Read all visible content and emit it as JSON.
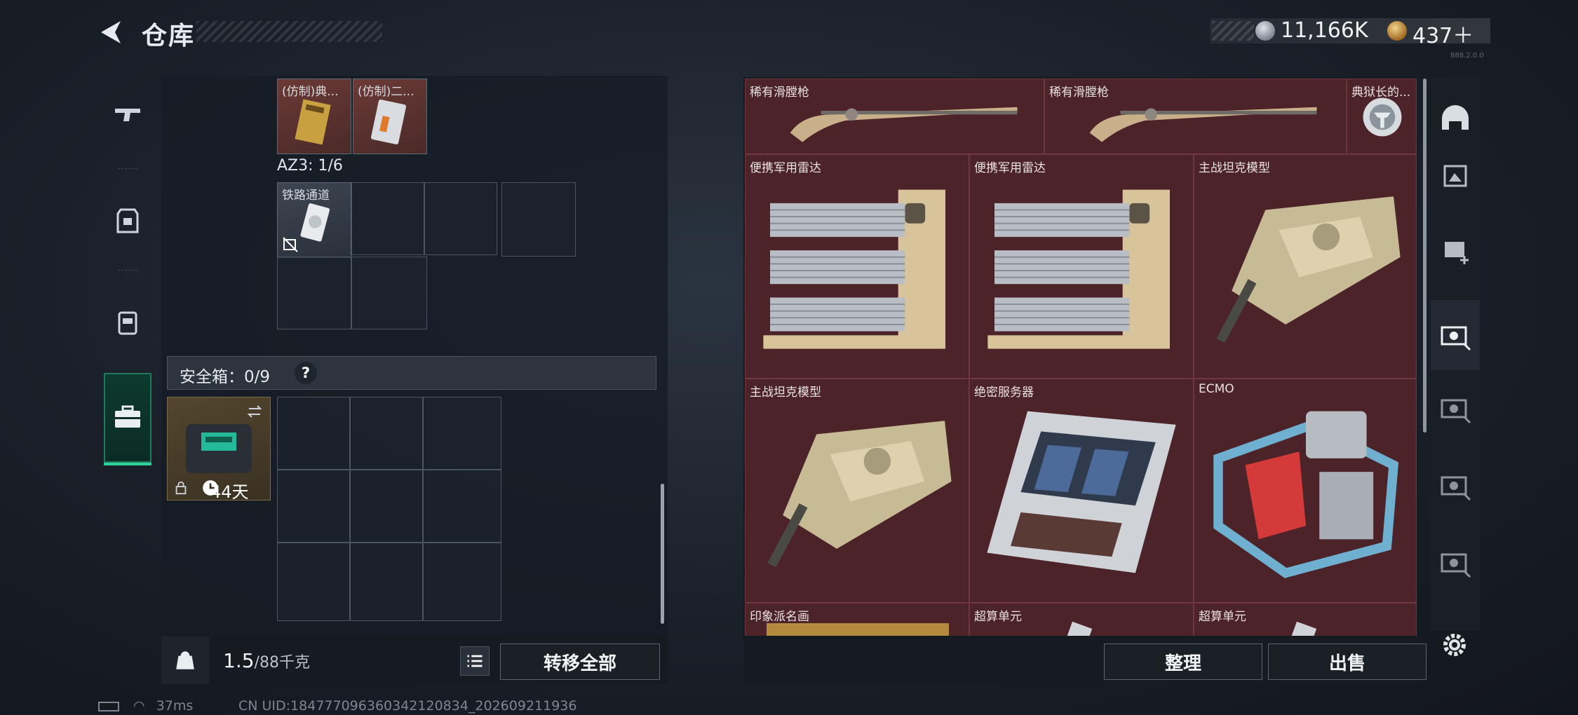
{
  "header": {
    "title": "仓库",
    "currency": [
      {
        "icon": "silver-coin-icon",
        "value": "11,166K"
      },
      {
        "icon": "gold-coin-icon",
        "value": "437＋"
      }
    ],
    "build": "888.2.0.0"
  },
  "left_rail": [
    {
      "name": "gun-icon",
      "active": false
    },
    {
      "name": "vest-icon",
      "active": false
    },
    {
      "name": "backpack-icon",
      "active": false
    },
    {
      "name": "case-icon",
      "active": true
    }
  ],
  "backpack": {
    "top_items": [
      {
        "label": "(仿制)典..."
      },
      {
        "label": "(仿制)二..."
      }
    ],
    "az3": {
      "label": "AZ3: 1/6"
    },
    "az3_items": [
      {
        "label": "铁路通道"
      }
    ]
  },
  "safe_box": {
    "label": "安全箱：0/9",
    "help": "?",
    "case_days": "44天"
  },
  "bottom_left": {
    "weight": "1.5",
    "weight_unit": "/88千克",
    "transfer_label": "转移全部"
  },
  "stash": {
    "rows": [
      [
        "稀有滑膛枪",
        "稀有滑膛枪",
        "典狱长的..."
      ],
      [
        "便携军用雷达",
        "便携军用雷达",
        "主战坦克模型"
      ],
      [
        "主战坦克模型",
        "绝密服务器",
        "ECMO"
      ],
      [
        "印象派名画",
        "超算单元",
        "超算单元"
      ]
    ],
    "sort_label": "整理",
    "sell_label": "出售"
  },
  "right_rail": [
    {
      "name": "helmet-icon"
    },
    {
      "name": "gpu-icon"
    },
    {
      "name": "iv-add-icon"
    },
    {
      "name": "v-card-icon",
      "active": true
    },
    {
      "name": "v-card-icon"
    },
    {
      "name": "v-card-icon"
    },
    {
      "name": "v-card-icon"
    }
  ],
  "status": {
    "ping": "37ms",
    "uid": "CN UID:184777096360342120834_202609211936"
  },
  "colors": {
    "accent_green": "#2fd29b",
    "stash_bg": "#4c2328",
    "panel_bg": "#161b22"
  }
}
